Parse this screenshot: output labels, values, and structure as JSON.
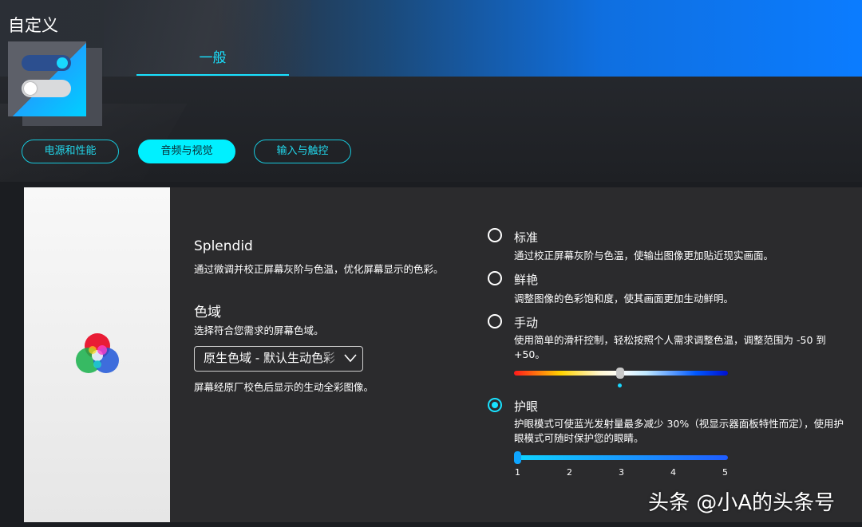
{
  "window": {
    "title": "自定义"
  },
  "main_tab": {
    "label": "一般"
  },
  "categories": [
    {
      "label": "电源和性能",
      "active": false
    },
    {
      "label": "音频与视觉",
      "active": true
    },
    {
      "label": "输入与触控",
      "active": false
    }
  ],
  "splendid": {
    "title": "Splendid",
    "description": "通过微调并校正屏幕灰阶与色温，优化屏幕显示的色彩。"
  },
  "gamut": {
    "title": "色域",
    "description": "选择符合您需求的屏幕色域。",
    "selected": "原生色域 - 默认生动色彩",
    "note": "屏幕经原厂校色后显示的生动全彩图像。"
  },
  "modes": [
    {
      "label": "标准",
      "description": "通过校正屏幕灰阶与色温，使输出图像更加贴近现实画面。",
      "checked": false
    },
    {
      "label": "鲜艳",
      "description": "调整图像的色彩饱和度，使其画面更加生动鲜明。",
      "checked": false
    },
    {
      "label": "手动",
      "description": "使用简单的滑杆控制，轻松按照个人需求调整色温，调整范围为 -50 到 +50。",
      "checked": false
    },
    {
      "label": "护眼",
      "description": "护眼模式可使蓝光发射量最多减少 30%（视显示器面板特性而定），使用护眼模式可随时保护您的眼睛。",
      "checked": true
    }
  ],
  "temperature_slider": {
    "min": -50,
    "max": 50,
    "value": 0
  },
  "eye_care_slider": {
    "ticks": [
      "1",
      "2",
      "3",
      "4",
      "5"
    ],
    "value": 1
  },
  "watermark": "头条 @小A的头条号",
  "colors": {
    "accent": "#19e2ff",
    "active_pill": "#00f0ff",
    "panel": "#2b2b2d"
  }
}
